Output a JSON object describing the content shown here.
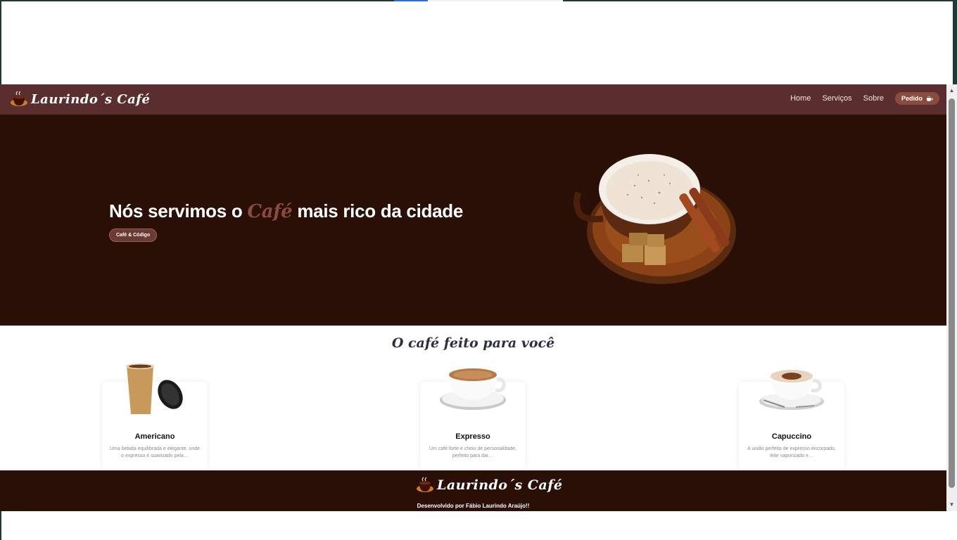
{
  "brand": {
    "name": "Laurindo´s Café"
  },
  "nav": {
    "items": [
      "Home",
      "Serviços",
      "Sobre"
    ],
    "cta_label": "Pedido"
  },
  "hero": {
    "title_before": "Nós servimos o ",
    "title_highlight": "Café",
    "title_after": " mais rico da cidade",
    "tag": "Café & Código"
  },
  "section": {
    "title": "O café feito para você"
  },
  "cards": [
    {
      "title": "Americano",
      "description": "Uma bebida equilibrada e elegante, onde o expresso é suavizado pela…"
    },
    {
      "title": "Expresso",
      "description": "Um café forte e cheio de personalidade, perfeito para dar…"
    },
    {
      "title": "Capuccino",
      "description": "A união perfeita de expresso encorpado, leite vaporizado e…"
    }
  ],
  "footer": {
    "brand": "Laurindo´s Café",
    "credit": "Desenvolvido por Fábio Laurindo Araújo!!"
  },
  "colors": {
    "navbar": "#5a2e2e",
    "hero_bg": "#2a0f07",
    "accent": "#8a4b3f"
  },
  "icons": {
    "logo": "coffee-cup-logo-icon",
    "cta": "coffee-cup-icon"
  }
}
